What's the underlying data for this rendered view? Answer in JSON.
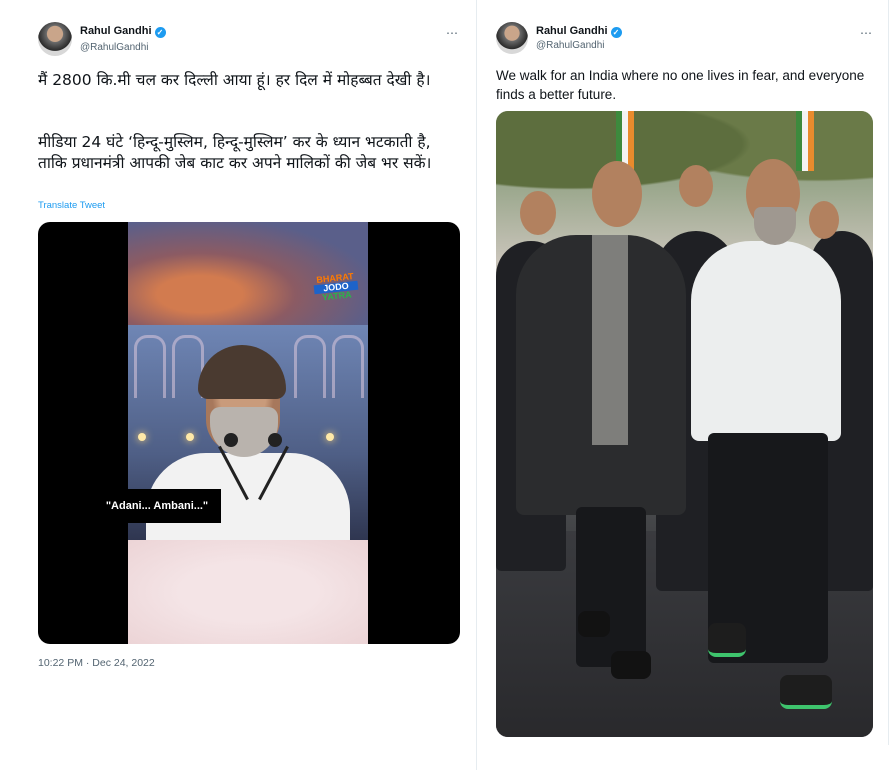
{
  "tweet_left": {
    "author_name": "Rahul Gandhi",
    "author_handle": "@RahulGandhi",
    "more_icon": "⋯",
    "text_para1": "मैं 2800 कि.मी चल कर दिल्ली आया हूं। हर दिल में मोहब्बत देखी है।",
    "text_para2": "मीडिया 24 घंटे ‘हिन्दू-मुस्लिम, हिन्दू-मुस्लिम’ कर के ध्यान भटकाती है, ताकि प्रधानमंत्री आपकी जेब काट कर अपने मालिकों की जेब भर सकें।",
    "translate_label": "Translate Tweet",
    "video": {
      "logo_line1": "BHARAT",
      "logo_line2": "JODO",
      "logo_line3": "YATRA",
      "caption": "\"Adani... Ambani...\""
    },
    "timestamp": "10:22 PM · Dec 24, 2022"
  },
  "tweet_right": {
    "author_name": "Rahul Gandhi",
    "author_handle": "@RahulGandhi",
    "more_icon": "⋯",
    "text": "We walk for an India where no one lives in fear, and everyone finds a better future."
  },
  "colors": {
    "verified_blue": "#1d9bf0",
    "link_blue": "#1d9bf0",
    "secondary_text": "#536471"
  }
}
